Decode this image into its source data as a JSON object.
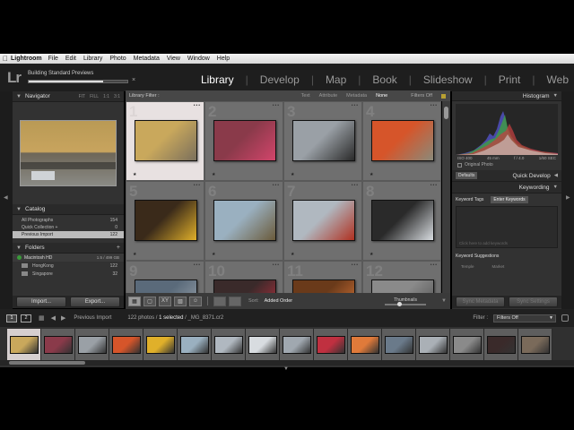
{
  "menubar": {
    "app": "Lightroom",
    "items": [
      "File",
      "Edit",
      "Library",
      "Photo",
      "Metadata",
      "View",
      "Window",
      "Help"
    ]
  },
  "activity": {
    "label": "Building Standard Previews",
    "progress": 0.75,
    "cancel": "×"
  },
  "logo": "Lr",
  "modules": [
    "Library",
    "Develop",
    "Map",
    "Book",
    "Slideshow",
    "Print",
    "Web"
  ],
  "active_module": "Library",
  "navigator": {
    "title": "Navigator",
    "zoom_options": [
      "FIT",
      "FILL",
      "1:1",
      "3:1"
    ]
  },
  "catalog": {
    "title": "Catalog",
    "rows": [
      {
        "label": "All Photographs",
        "count": "154"
      },
      {
        "label": "Quick Collection +",
        "count": "0"
      },
      {
        "label": "Previous Import",
        "count": "122"
      }
    ]
  },
  "folders": {
    "title": "Folders",
    "volume": {
      "name": "Macintosh HD",
      "size": "1.5 / 499 GB"
    },
    "rows": [
      {
        "label": "HongKong",
        "count": "122"
      },
      {
        "label": "Singapore",
        "count": "32"
      }
    ]
  },
  "import_buttons": {
    "import": "Import...",
    "export": "Export..."
  },
  "filter_bar": {
    "label": "Library Filter :",
    "options": [
      "Text",
      "Attribute",
      "Metadata",
      "None"
    ],
    "active": "None",
    "filters_off": "Filters Off"
  },
  "grid": {
    "cells": [
      {
        "index": "1",
        "selected": true,
        "colors": [
          "#c9a85c",
          "#7a6f5c"
        ]
      },
      {
        "index": "2",
        "selected": false,
        "colors": [
          "#8a3a4a",
          "#d2456b"
        ]
      },
      {
        "index": "3",
        "selected": false,
        "colors": [
          "#9aa0a6",
          "#2a2a2a"
        ]
      },
      {
        "index": "4",
        "selected": false,
        "colors": [
          "#d6552a",
          "#8a8a7a"
        ]
      },
      {
        "index": "5",
        "selected": false,
        "colors": [
          "#3a2a1a",
          "#e0b02a"
        ]
      },
      {
        "index": "6",
        "selected": false,
        "colors": [
          "#9ab0c0",
          "#6a5a3a"
        ]
      },
      {
        "index": "7",
        "selected": false,
        "colors": [
          "#b0b8c0",
          "#b03020"
        ]
      },
      {
        "index": "8",
        "selected": false,
        "colors": [
          "#2a2a2a",
          "#d8dce0"
        ]
      },
      {
        "index": "9",
        "selected": false,
        "colors": [
          "#5a6a7a",
          "#a0a8b0"
        ]
      },
      {
        "index": "10",
        "selected": false,
        "colors": [
          "#3a2a2a",
          "#c03040"
        ]
      },
      {
        "index": "11",
        "selected": false,
        "colors": [
          "#6a3a1a",
          "#e07a3a"
        ]
      },
      {
        "index": "12",
        "selected": false,
        "colors": [
          "#8a8a8a",
          "#4a4a4a"
        ]
      }
    ]
  },
  "toolbar": {
    "sort_label": "Sort:",
    "sort_value": "Added Order",
    "thumbnails_label": "Thumbnails"
  },
  "histogram": {
    "title": "Histogram",
    "iso": "ISO 400",
    "focal": "45 mm",
    "aperture": "f / 4.0",
    "shutter": "1/60 SEC",
    "original_photo": "Original Photo"
  },
  "quick_develop": {
    "title": "Quick Develop",
    "preset": "Defaults"
  },
  "keywording": {
    "title": "Keywording",
    "tags_label": "Keyword Tags",
    "tags_mode": "Enter Keywords",
    "placeholder": "Click here to add keywords",
    "suggestions_label": "Keyword Suggestions",
    "suggestions": [
      "Temple",
      "Market"
    ]
  },
  "sync_buttons": {
    "metadata": "Sync Metadata",
    "settings": "Sync Settings"
  },
  "filmstrip": {
    "monitors": [
      "1",
      "2"
    ],
    "source": "Previous Import",
    "count_prefix": "122 photos / ",
    "count_selected": "1 selected",
    "filename": " / _MG_8371.cr2",
    "filter_label": "Filter :",
    "filter_value": "Filters Off",
    "thumbs": [
      "#c9a85c",
      "#8a3a4a",
      "#9aa0a6",
      "#d6552a",
      "#e0b02a",
      "#9ab0c0",
      "#b0b8c0",
      "#d8dce0",
      "#a0a8b0",
      "#c03040",
      "#e07a3a",
      "#6a7a8a",
      "#aab0b6",
      "#8a8a8a",
      "#3a2a2a",
      "#7a6a5a"
    ]
  }
}
